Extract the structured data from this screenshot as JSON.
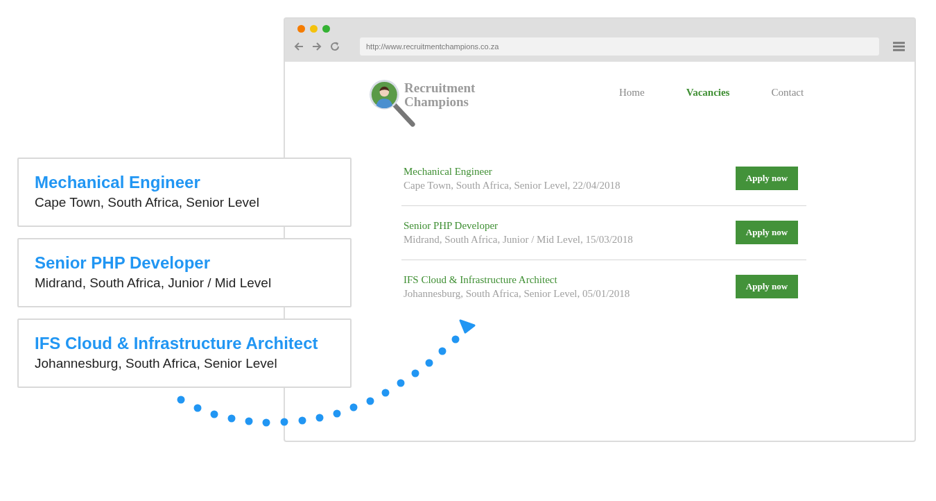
{
  "browser": {
    "url": "http://www.recruitmentchampions.co.za"
  },
  "site": {
    "logo_lines": [
      "Recruitment",
      "Champions"
    ],
    "nav": [
      {
        "label": "Home",
        "selected": false
      },
      {
        "label": "Vacancies",
        "selected": true
      },
      {
        "label": "Contact",
        "selected": false
      }
    ],
    "vacancies": [
      {
        "title": "Mechanical Engineer",
        "details": "Cape Town, South Africa, Senior Level, 22/04/2018",
        "button": "Apply now"
      },
      {
        "title": "Senior PHP Developer",
        "details": "Midrand, South Africa, Junior / Mid Level, 15/03/2018",
        "button": "Apply now"
      },
      {
        "title": "IFS Cloud & Infrastructure Architect",
        "details": "Johannesburg, South Africa, Senior Level, 05/01/2018",
        "button": "Apply now"
      }
    ]
  },
  "cards": [
    {
      "title": "Mechanical Engineer",
      "details": "Cape Town, South Africa, Senior Level"
    },
    {
      "title": "Senior PHP Developer",
      "details": "Midrand, South Africa, Junior / Mid Level"
    },
    {
      "title": "IFS Cloud & Infrastructure Architect",
      "details": "Johannesburg, South Africa, Senior Level"
    }
  ]
}
